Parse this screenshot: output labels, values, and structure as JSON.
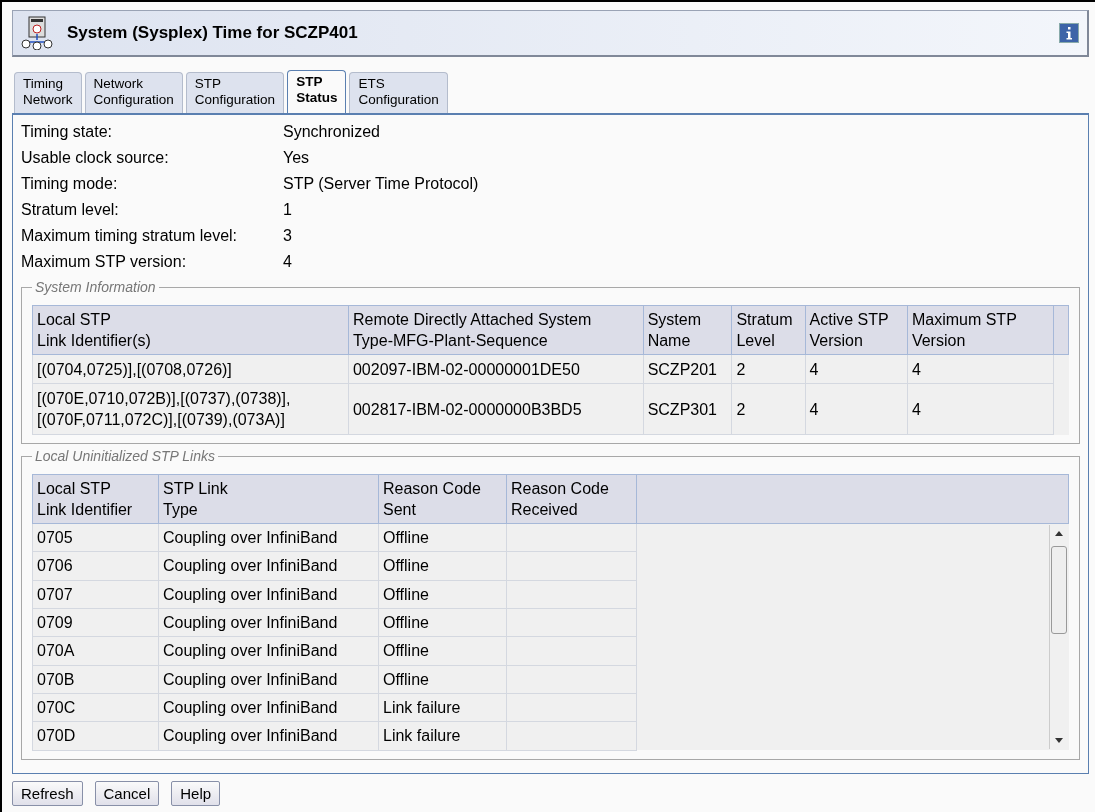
{
  "window": {
    "title": "System (Sysplex) Time for SCZP401"
  },
  "tabs": [
    {
      "lines": [
        "Timing",
        "Network"
      ],
      "selected": false
    },
    {
      "lines": [
        "Network",
        "Configuration"
      ],
      "selected": false
    },
    {
      "lines": [
        "STP",
        "Configuration"
      ],
      "selected": false
    },
    {
      "lines": [
        "STP",
        "Status"
      ],
      "selected": true
    },
    {
      "lines": [
        "ETS",
        "Configuration"
      ],
      "selected": false
    }
  ],
  "status_fields": [
    {
      "label": "Timing state:",
      "value": "Synchronized"
    },
    {
      "label": "Usable clock source:",
      "value": "Yes"
    },
    {
      "label": "Timing mode:",
      "value": "STP (Server Time Protocol)"
    },
    {
      "label": "Stratum level:",
      "value": "1"
    },
    {
      "label": "Maximum timing stratum level:",
      "value": "3"
    },
    {
      "label": "Maximum STP version:",
      "value": "4"
    }
  ],
  "system_information": {
    "title": "System Information",
    "columns": [
      "Local STP\nLink Identifier(s)",
      "Remote Directly Attached System\nType-MFG-Plant-Sequence",
      "System\nName",
      "Stratum\nLevel",
      "Active STP\nVersion",
      "Maximum STP\nVersion"
    ],
    "rows": [
      [
        "[(0704,0725)],[(0708,0726)]",
        "002097-IBM-02-00000001DE50",
        "SCZP201",
        "2",
        "4",
        "4"
      ],
      [
        "[(070E,0710,072B)],[(0737),(0738)],\n[(070F,0711,072C)],[(0739),(073A)]",
        "002817-IBM-02-0000000B3BD5",
        "SCZP301",
        "2",
        "4",
        "4"
      ]
    ]
  },
  "uninitialized_links": {
    "title": "Local Uninitialized STP Links",
    "columns": [
      "Local STP\nLink Identifier",
      "STP Link\nType",
      "Reason Code\nSent",
      "Reason Code\nReceived"
    ],
    "rows": [
      [
        "0705",
        "Coupling over InfiniBand",
        "Offline",
        ""
      ],
      [
        "0706",
        "Coupling over InfiniBand",
        "Offline",
        ""
      ],
      [
        "0707",
        "Coupling over InfiniBand",
        "Offline",
        ""
      ],
      [
        "0709",
        "Coupling over InfiniBand",
        "Offline",
        ""
      ],
      [
        "070A",
        "Coupling over InfiniBand",
        "Offline",
        ""
      ],
      [
        "070B",
        "Coupling over InfiniBand",
        "Offline",
        ""
      ],
      [
        "070C",
        "Coupling over InfiniBand",
        "Link failure",
        ""
      ],
      [
        "070D",
        "Coupling over InfiniBand",
        "Link failure",
        ""
      ]
    ]
  },
  "buttons": [
    "Refresh",
    "Cancel",
    "Help"
  ]
}
